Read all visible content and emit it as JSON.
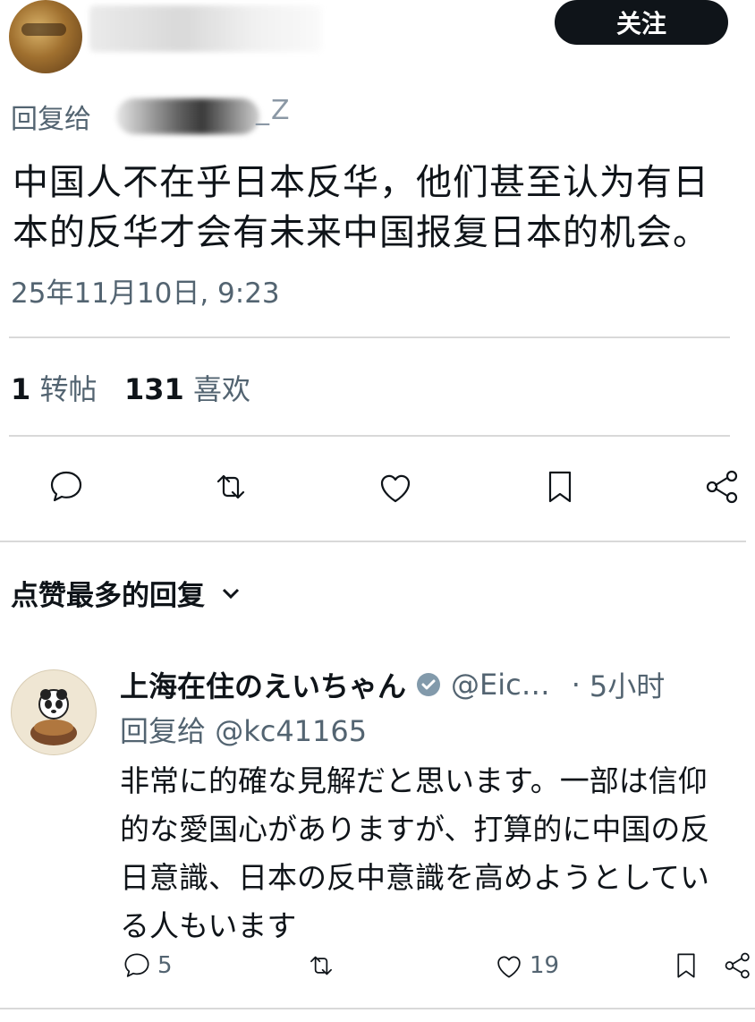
{
  "header": {
    "follow_label": "关注",
    "reply_to_label": "回复给",
    "handle_tail": "_Z"
  },
  "tweet": {
    "text_line1": "中国人不在乎日本反华，他们甚至认为有日",
    "text_line2": "本的反华才会有未来中国报复日本的机会。",
    "timestamp": "25年11月10日, 9:23",
    "repost_count": "1",
    "repost_label": "转帖",
    "like_count": "131",
    "like_label": "喜欢"
  },
  "actions": {
    "icons": [
      "reply-icon",
      "repost-icon",
      "like-icon",
      "bookmark-icon",
      "share-icon"
    ]
  },
  "replies_section": {
    "sort_label": "点赞最多的回复"
  },
  "top_reply": {
    "name": "上海在住のえいちゃん",
    "handle": "@Eic…",
    "separator": "·",
    "time": "5小时",
    "reply_to_label": "回复给",
    "reply_to_handle": "@kc41165",
    "text_line1": "非常に的確な見解だと思います。一部は信仰",
    "text_line2": "的な愛国心がありますが、打算的に中国の反",
    "text_line3": "日意識、日本の反中意識を高めようとしてい",
    "text_line4": "る人もいます",
    "reply_count": "5",
    "repost_count": "",
    "like_count": "19"
  },
  "colors": {
    "text_primary": "#0f1419",
    "text_secondary": "#536471",
    "button_bg": "#0f1419",
    "verified": "#829aab"
  }
}
